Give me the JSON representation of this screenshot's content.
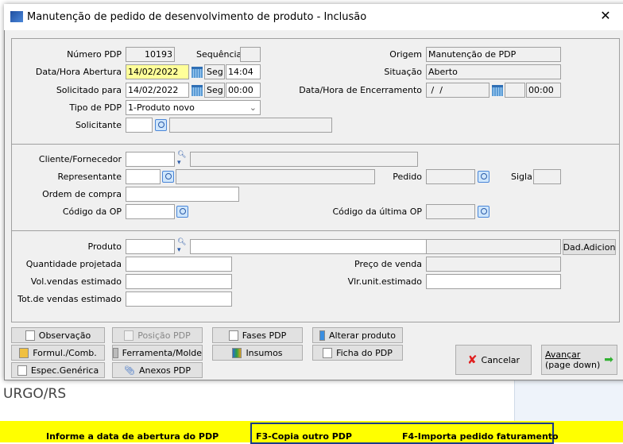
{
  "window": {
    "title": "Manutenção de pedido de desenvolvimento de produto - Inclusão",
    "close": "✕"
  },
  "form": {
    "numero_pdp": {
      "label": "Número PDP",
      "value": "10193"
    },
    "sequencia": {
      "label": "Sequência",
      "value": ""
    },
    "data_abertura": {
      "label": "Data/Hora Abertura",
      "date": "14/02/2022",
      "day": "Seg",
      "time": "14:04"
    },
    "solicitado_para": {
      "label": "Solicitado para",
      "date": "14/02/2022",
      "day": "Seg",
      "time": "00:00"
    },
    "tipo_pdp": {
      "label": "Tipo de PDP",
      "value": "1-Produto novo"
    },
    "solicitante": {
      "label": "Solicitante"
    },
    "origem": {
      "label": "Origem",
      "value": "Manutenção de PDP"
    },
    "situacao": {
      "label": "Situação",
      "value": "Aberto"
    },
    "encerramento": {
      "label": "Data/Hora de Encerramento",
      "date": " /  /",
      "time": "00:00"
    },
    "cliente": {
      "label": "Cliente/Fornecedor"
    },
    "representante": {
      "label": "Representante"
    },
    "pedido": {
      "label": "Pedido"
    },
    "sigla": {
      "label": "Sigla"
    },
    "ordem_compra": {
      "label": "Ordem de compra"
    },
    "codigo_op": {
      "label": "Código da OP"
    },
    "codigo_ultima_op": {
      "label": "Código da última OP"
    },
    "produto": {
      "label": "Produto",
      "button": "Dad.Adicion"
    },
    "qtd_projetada": {
      "label": "Quantidade projetada"
    },
    "preco_venda": {
      "label": "Preço de venda"
    },
    "vol_vendas": {
      "label": "Vol.vendas estimado"
    },
    "vlr_unit": {
      "label": "Vlr.unit.estimado"
    },
    "tot_vendas": {
      "label": "Tot.de vendas estimado"
    }
  },
  "buttons": {
    "observacao": "Observação",
    "posicao": "Posição PDP",
    "fases": "Fases PDP",
    "alterar": "Alterar produto",
    "formul": "Formul./Comb.",
    "ferramenta": "Ferramenta/Molde",
    "insumos": "Insumos",
    "ficha": "Ficha do PDP",
    "espec": "Espec.Genérica",
    "anexos": "Anexos PDP",
    "cancelar": "Cancelar",
    "avancar": "Avançar",
    "avancar_sub": "(page down)"
  },
  "background": {
    "text": "URGO/RS"
  },
  "statusbar": {
    "hint": "Informe a data de abertura do PDP",
    "f3": "F3-Copia outro PDP",
    "f4": "F4-Importa pedido faturamento"
  }
}
